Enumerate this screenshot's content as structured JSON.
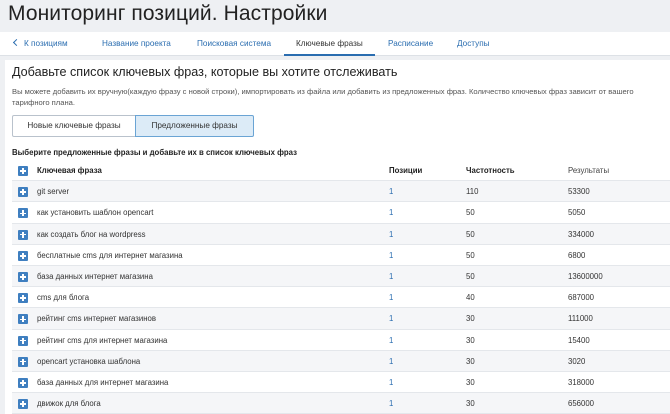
{
  "page": {
    "title": "Мониторинг позиций. Настройки"
  },
  "tabs": {
    "back": "К позициям",
    "items": [
      {
        "label": "Название проекта"
      },
      {
        "label": "Поисковая система"
      },
      {
        "label": "Ключевые фразы"
      },
      {
        "label": "Расписание"
      },
      {
        "label": "Доступы"
      }
    ],
    "active": "Ключевые фразы"
  },
  "section": {
    "title": "Добавьте список ключевых фраз, которые вы хотите отслеживать",
    "hint": "Вы можете добавить их вручную(каждую фразу с новой строки), импортировать из файла или добавить из предложенных фраз. Количество ключевых фраз зависит от вашего тарифного плана."
  },
  "segment": {
    "new_label": "Новые ключевые фразы",
    "suggested_label": "Предложенные фразы",
    "selected": "Предложенные фразы"
  },
  "table": {
    "caption": "Выберите предложенные фразы и добавьте их в список ключевых фраз",
    "headers": {
      "phrase": "Ключевая фраза",
      "positions": "Позиции",
      "frequency": "Частотность",
      "results": "Результаты"
    },
    "rows": [
      {
        "phrase": "git server",
        "positions": "1",
        "frequency": "110",
        "results": "53300"
      },
      {
        "phrase": "как установить шаблон opencart",
        "positions": "1",
        "frequency": "50",
        "results": "5050"
      },
      {
        "phrase": "как создать блог на wordpress",
        "positions": "1",
        "frequency": "50",
        "results": "334000"
      },
      {
        "phrase": "бесплатные cms для интернет магазина",
        "positions": "1",
        "frequency": "50",
        "results": "6800"
      },
      {
        "phrase": "база данных интернет магазина",
        "positions": "1",
        "frequency": "50",
        "results": "13600000"
      },
      {
        "phrase": "cms для блога",
        "positions": "1",
        "frequency": "40",
        "results": "687000"
      },
      {
        "phrase": "рейтинг cms интернет магазинов",
        "positions": "1",
        "frequency": "30",
        "results": "111000"
      },
      {
        "phrase": "рейтинг cms для интернет магазина",
        "positions": "1",
        "frequency": "30",
        "results": "15400"
      },
      {
        "phrase": "opencart установка шаблона",
        "positions": "1",
        "frequency": "30",
        "results": "3020"
      },
      {
        "phrase": "база данных для интернет магазина",
        "positions": "1",
        "frequency": "30",
        "results": "318000"
      },
      {
        "phrase": "движок для блога",
        "positions": "1",
        "frequency": "30",
        "results": "656000"
      }
    ]
  },
  "colors": {
    "accent": "#2a6db0",
    "plus_button": "#3f7fc0",
    "selected_segment": "#dcebf7"
  }
}
